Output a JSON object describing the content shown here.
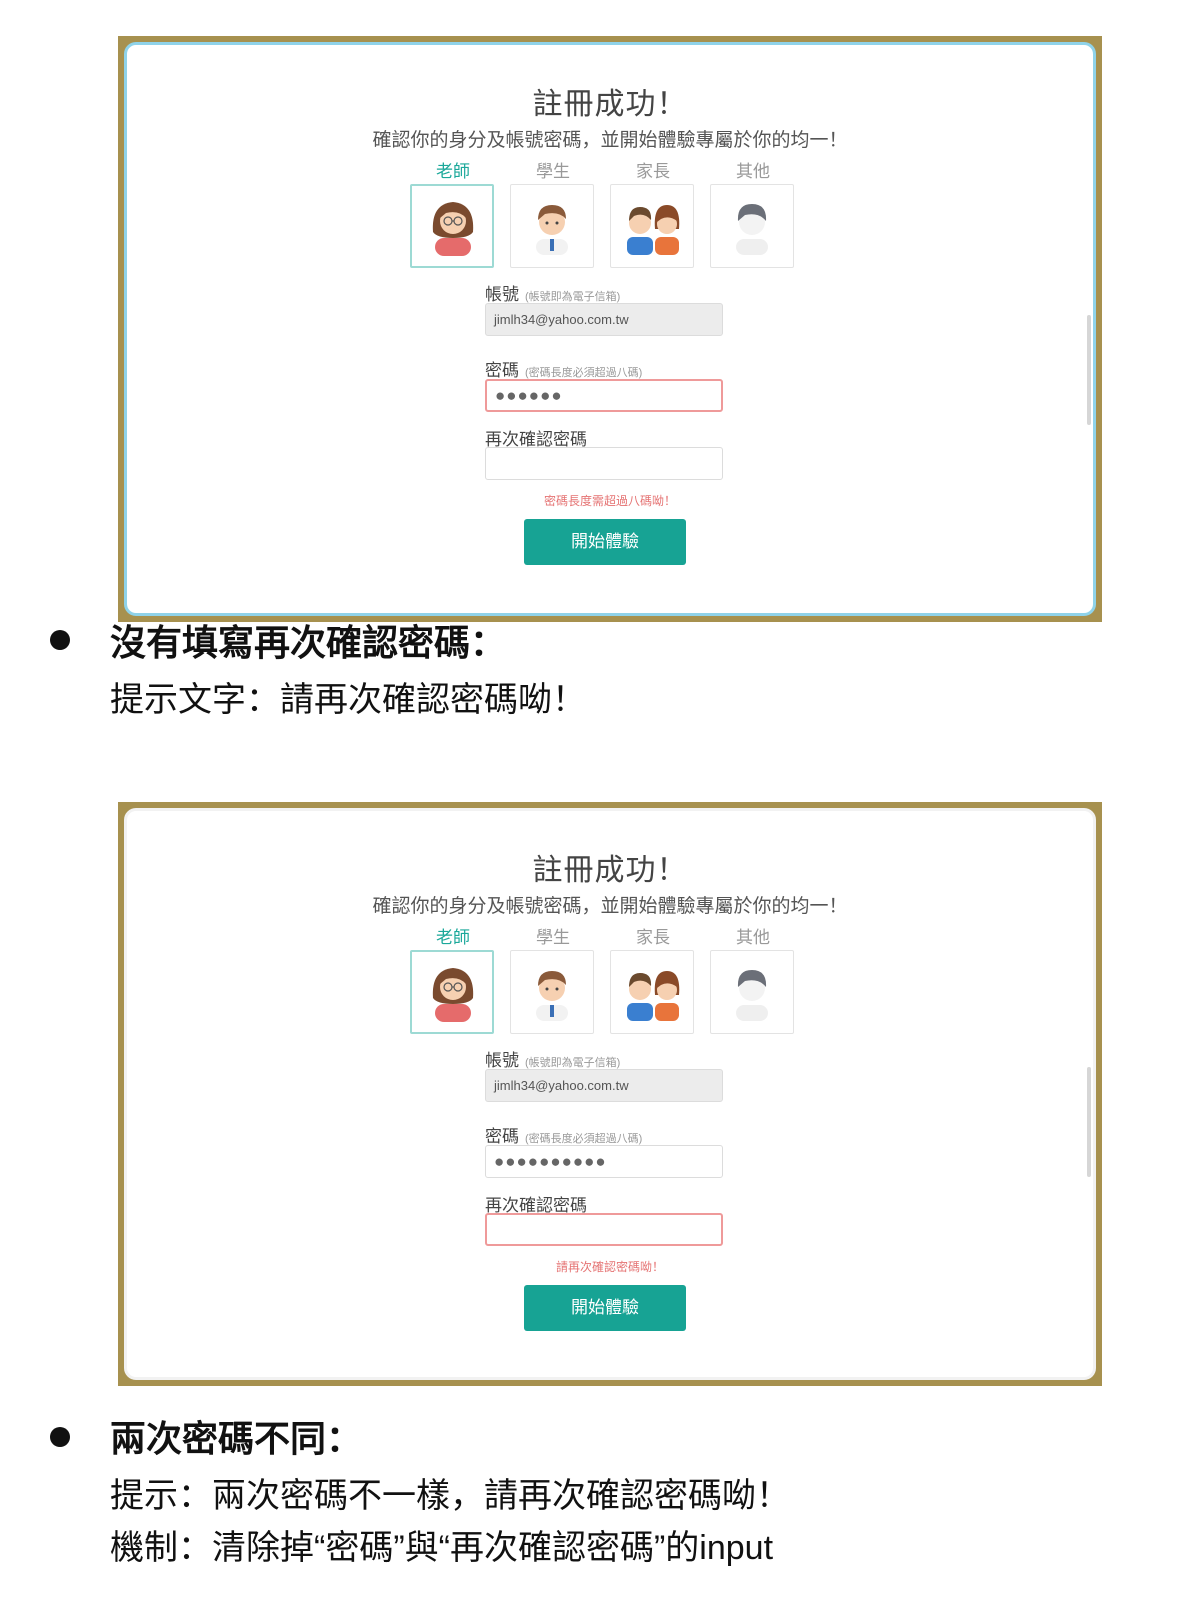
{
  "dialog1": {
    "title": "註冊成功！",
    "subtitle": "確認你的身分及帳號密碼，並開始體驗專屬於你的均一！",
    "roles": [
      {
        "label": "老師",
        "active": true
      },
      {
        "label": "學生",
        "active": false
      },
      {
        "label": "家長",
        "active": false
      },
      {
        "label": "其他",
        "active": false
      }
    ],
    "account_label": "帳號",
    "account_hint": "(帳號即為電子信箱)",
    "account_value": "jimlh34@yahoo.com.tw",
    "password_label": "密碼",
    "password_hint": "(密碼長度必須超過八碼)",
    "password_value": "●●●●●●",
    "confirm_label": "再次確認密碼",
    "confirm_value": "",
    "error_message": "密碼長度需超過八碼呦！",
    "submit_label": "開始體驗"
  },
  "section1": {
    "heading": "沒有填寫再次確認密碼：",
    "body": "提示文字：請再次確認密碼呦！"
  },
  "dialog2": {
    "title": "註冊成功！",
    "subtitle": "確認你的身分及帳號密碼，並開始體驗專屬於你的均一！",
    "roles": [
      {
        "label": "老師",
        "active": true
      },
      {
        "label": "學生",
        "active": false
      },
      {
        "label": "家長",
        "active": false
      },
      {
        "label": "其他",
        "active": false
      }
    ],
    "account_label": "帳號",
    "account_hint": "(帳號即為電子信箱)",
    "account_value": "jimlh34@yahoo.com.tw",
    "password_label": "密碼",
    "password_hint": "(密碼長度必須超過八碼)",
    "password_value": "●●●●●●●●●●",
    "confirm_label": "再次確認密碼",
    "confirm_value": "",
    "error_message": "請再次確認密碼呦！",
    "submit_label": "開始體驗"
  },
  "section2": {
    "heading": "兩次密碼不同：",
    "body_line1": "提示：兩次密碼不一樣，請再次確認密碼呦！",
    "body_line2": "機制：清除掉“密碼”與“再次確認密碼”的input"
  },
  "colors": {
    "accent": "#17a394",
    "error": "#e57373",
    "frame": "#a7914f",
    "active_border": "#9ddad4"
  },
  "icons": [
    "teacher-avatar-icon",
    "student-avatar-icon",
    "parent-avatar-icon",
    "other-avatar-icon"
  ]
}
